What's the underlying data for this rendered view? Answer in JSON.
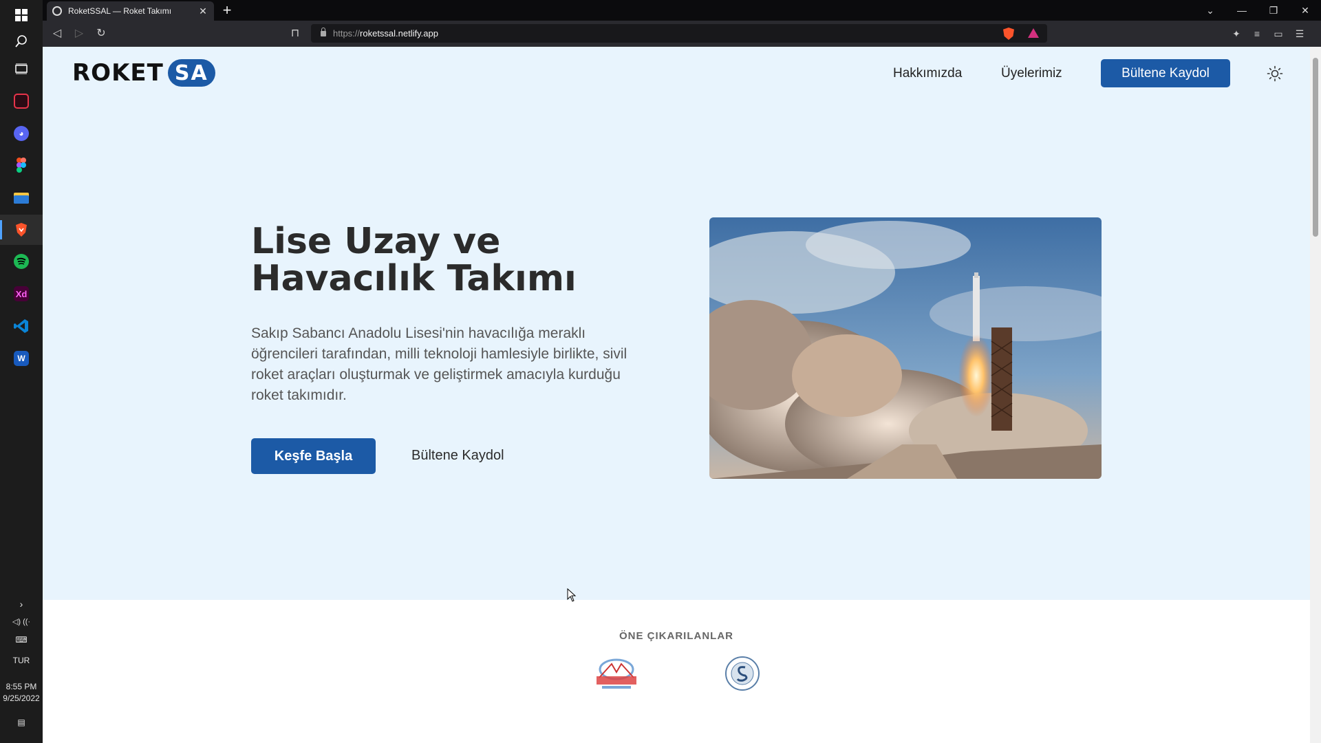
{
  "taskbar": {
    "apps": [
      {
        "name": "windows-start",
        "color": "#2b2b2b",
        "glyph": "⊞"
      },
      {
        "name": "search",
        "color": "#1c1c1c",
        "glyph": "⌕"
      },
      {
        "name": "task-view",
        "color": "#1c1c1c",
        "glyph": "▣"
      },
      {
        "name": "terminal",
        "color": "#e8344a",
        "glyph": ">_"
      },
      {
        "name": "discord",
        "color": "#5865f2",
        "glyph": "D"
      },
      {
        "name": "figma",
        "color": "#f24e1e",
        "glyph": "F"
      },
      {
        "name": "file-explorer",
        "color": "#f4c542",
        "glyph": ""
      },
      {
        "name": "brave",
        "color": "#fb542b",
        "glyph": "B"
      },
      {
        "name": "spotify",
        "color": "#1db954",
        "glyph": "S"
      },
      {
        "name": "adobe-xd",
        "color": "#470137",
        "glyph": "Xd"
      },
      {
        "name": "vscode",
        "color": "#0078d4",
        "glyph": "<>"
      },
      {
        "name": "word",
        "color": "#185abd",
        "glyph": "W"
      }
    ],
    "language": "TUR",
    "time": "8:55 PM",
    "date": "9/25/2022"
  },
  "browser": {
    "tab_title": "RoketSSAL — Roket Takımı",
    "url_proto": "https://",
    "url_host": "roketssal.netlify.app"
  },
  "page": {
    "logo_text": "ROKET",
    "logo_badge": "SA",
    "nav": {
      "about": "Hakkımızda",
      "members": "Üyelerimiz",
      "cta": "Bültene Kaydol"
    },
    "hero": {
      "title_line1": "Lise Uzay ve",
      "title_line2": "Havacılık Takımı",
      "lead": "Sakıp Sabancı Anadolu Lisesi'nin havacılığa meraklı öğrencileri tarafından, milli teknoloji hamlesiyle birlikte, sivil roket araçları oluşturmak ve geliştirmek amacıyla kurduğu roket takımıdır.",
      "primary_button": "Keşfe Başla",
      "secondary_button": "Bültene Kaydol"
    },
    "highlights": {
      "title": "ÖNE ÇIKARILANLAR",
      "logos": [
        "teknofest-logo",
        "school-seal-logo"
      ]
    }
  },
  "colors": {
    "brand": "#1c5aa6",
    "hero_bg": "#e8f4fd"
  }
}
